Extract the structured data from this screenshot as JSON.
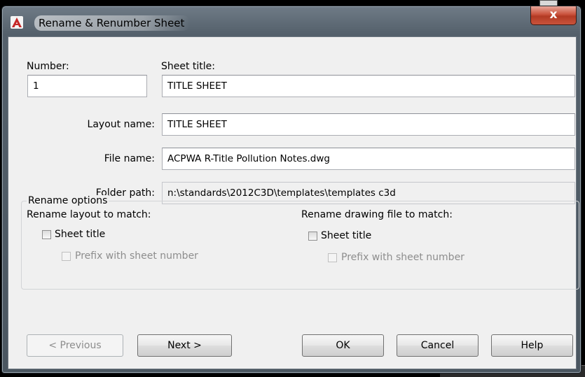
{
  "dialog": {
    "title": "Rename & Renumber Sheet",
    "close_symbol": "x"
  },
  "fields": {
    "number_label": "Number:",
    "number_value": "1",
    "sheet_title_label": "Sheet title:",
    "sheet_title_value": "TITLE SHEET",
    "layout_name_label": "Layout name:",
    "layout_name_value": "TITLE SHEET",
    "file_name_label": "File name:",
    "file_name_value": "ACPWA R-Title Pollution Notes.dwg",
    "folder_path_label": "Folder path:",
    "folder_path_value": "n:\\standards\\2012C3D\\templates\\templates c3d"
  },
  "rename_options": {
    "legend": "Rename options",
    "layout": {
      "heading": "Rename layout to match:",
      "sheet_title_label": "Sheet title",
      "sheet_title_checked": false,
      "prefix_label": "Prefix with sheet number",
      "prefix_enabled": false
    },
    "drawing": {
      "heading": "Rename drawing file to match:",
      "sheet_title_label": "Sheet title",
      "sheet_title_checked": false,
      "prefix_label": "Prefix with sheet number",
      "prefix_enabled": false
    }
  },
  "buttons": {
    "previous": "< Previous",
    "next": "Next >",
    "ok": "OK",
    "cancel": "Cancel",
    "help": "Help"
  },
  "icons": {
    "app": "autocad-a-icon",
    "close": "close-icon"
  },
  "colors": {
    "title_bar": "#54606b",
    "close_button": "#c9503a",
    "dialog_bg": "#f0f0f0",
    "app_icon_red": "#c62828"
  }
}
